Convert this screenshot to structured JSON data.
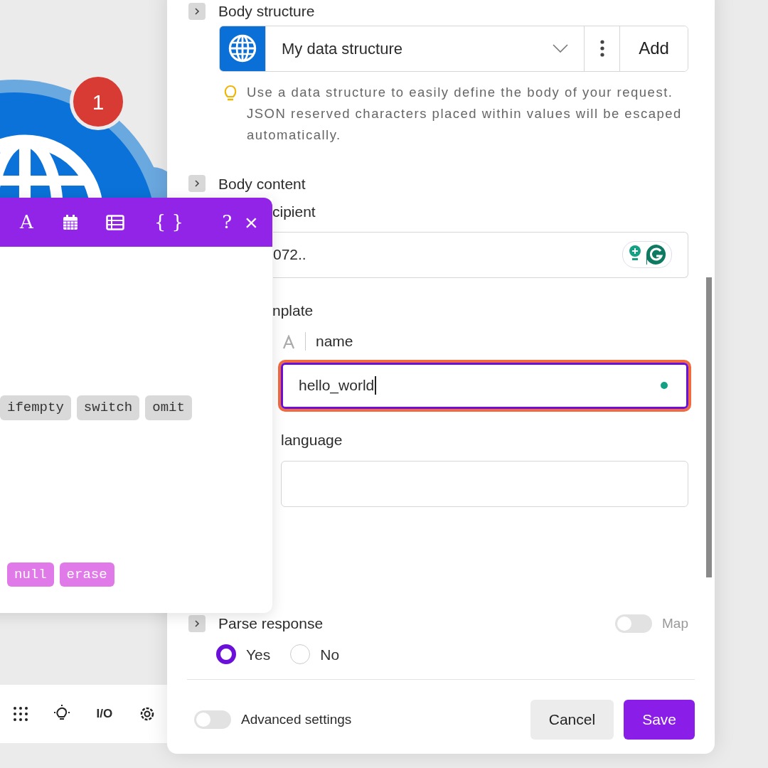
{
  "canvas": {
    "module": {
      "badge": "1"
    },
    "toolbar": [
      {
        "kind": "grid"
      },
      {
        "kind": "bulb"
      },
      {
        "kind": "text",
        "label": "I/O"
      },
      {
        "kind": "gear"
      }
    ]
  },
  "mapping_panel": {
    "toolbar": [
      {
        "kind": "text",
        "label": "A"
      },
      {
        "kind": "calendar"
      },
      {
        "kind": "table"
      },
      {
        "kind": "text",
        "label": "{ }"
      },
      {
        "kind": "text",
        "label": "?"
      },
      {
        "kind": "close",
        "label": "×"
      }
    ],
    "general_functions": [
      "ifempty",
      "switch",
      "omit"
    ],
    "keywords": [
      "null",
      "erase"
    ]
  },
  "dialog": {
    "body_structure": {
      "label": "Body structure",
      "expanded": false,
      "select": {
        "value": "My data structure"
      },
      "add_button": "Add",
      "hint": "Use a data structure to easily define the body of your request. JSON reserved characters placed within values will be escaped automatically."
    },
    "body_content": {
      "label": "Body content",
      "expanded": false
    },
    "recipient": {
      "label": "cipient",
      "value": "072.."
    },
    "template": {
      "label": "nplate",
      "name": {
        "label": "name",
        "value": "hello_world",
        "focused": true
      },
      "language": {
        "label": "language",
        "focused": false
      }
    },
    "parse_response": {
      "label": "Parse response",
      "expanded": false,
      "map": {
        "label": "Map",
        "on": false
      },
      "options": [
        {
          "label": "Yes",
          "selected": true
        },
        {
          "label": "No",
          "selected": false
        }
      ]
    },
    "footer": {
      "advanced": {
        "label": "Advanced settings",
        "on": false
      },
      "buttons": [
        {
          "label": "Cancel",
          "kind": "secondary"
        },
        {
          "label": "Save",
          "kind": "primary"
        }
      ]
    }
  }
}
